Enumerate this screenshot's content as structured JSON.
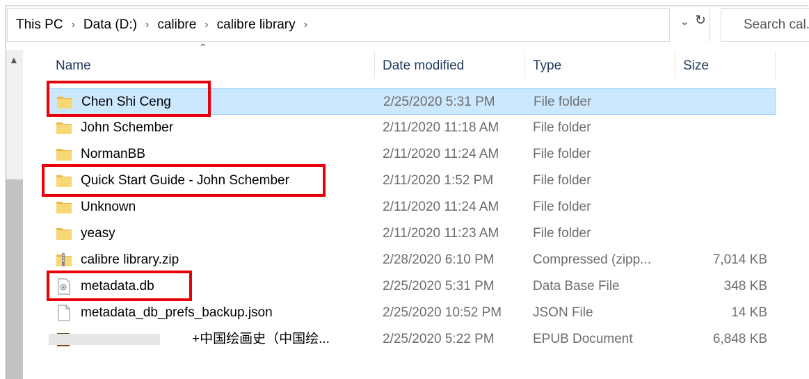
{
  "breadcrumb": {
    "items": [
      "This PC",
      "Data (D:)",
      "calibre",
      "calibre library"
    ],
    "separator": "›"
  },
  "search": {
    "placeholder": "Search cal..."
  },
  "columns": {
    "name": "Name",
    "date": "Date modified",
    "type": "Type",
    "size": "Size"
  },
  "files": [
    {
      "name": "Chen Shi Ceng",
      "date": "2/25/2020 5:31 PM",
      "type": "File folder",
      "size": "",
      "icon": "folder-icon",
      "selected": true
    },
    {
      "name": "John Schember",
      "date": "2/11/2020 11:18 AM",
      "type": "File folder",
      "size": "",
      "icon": "folder-icon"
    },
    {
      "name": "NormanBB",
      "date": "2/11/2020 11:24 AM",
      "type": "File folder",
      "size": "",
      "icon": "folder-icon"
    },
    {
      "name": "Quick Start Guide - John Schember",
      "date": "2/11/2020 1:52 PM",
      "type": "File folder",
      "size": "",
      "icon": "folder-icon"
    },
    {
      "name": "Unknown",
      "date": "2/11/2020 11:24 AM",
      "type": "File folder",
      "size": "",
      "icon": "folder-icon"
    },
    {
      "name": "yeasy",
      "date": "2/11/2020 11:23 AM",
      "type": "File folder",
      "size": "",
      "icon": "folder-icon"
    },
    {
      "name": "calibre library.zip",
      "date": "2/28/2020 6:10 PM",
      "type": "Compressed (zipp...",
      "size": "7,014 KB",
      "icon": "zip-icon"
    },
    {
      "name": "metadata.db",
      "date": "2/25/2020 5:31 PM",
      "type": "Data Base File",
      "size": "348 KB",
      "icon": "database-file-icon"
    },
    {
      "name": "metadata_db_prefs_backup.json",
      "date": "2/25/2020 10:52 PM",
      "type": "JSON File",
      "size": "14 KB",
      "icon": "file-icon"
    },
    {
      "name": "+中国绘画史（中国绘...",
      "date": "2/25/2020 5:22 PM",
      "type": "EPUB Document",
      "size": "6,848 KB",
      "icon": "epub-icon",
      "blurred_prefix": true
    }
  ],
  "colors": {
    "selection": "#cce8ff",
    "selection_border": "#99d1ff",
    "highlight": "#e8000b",
    "folder": "#f8d775"
  }
}
